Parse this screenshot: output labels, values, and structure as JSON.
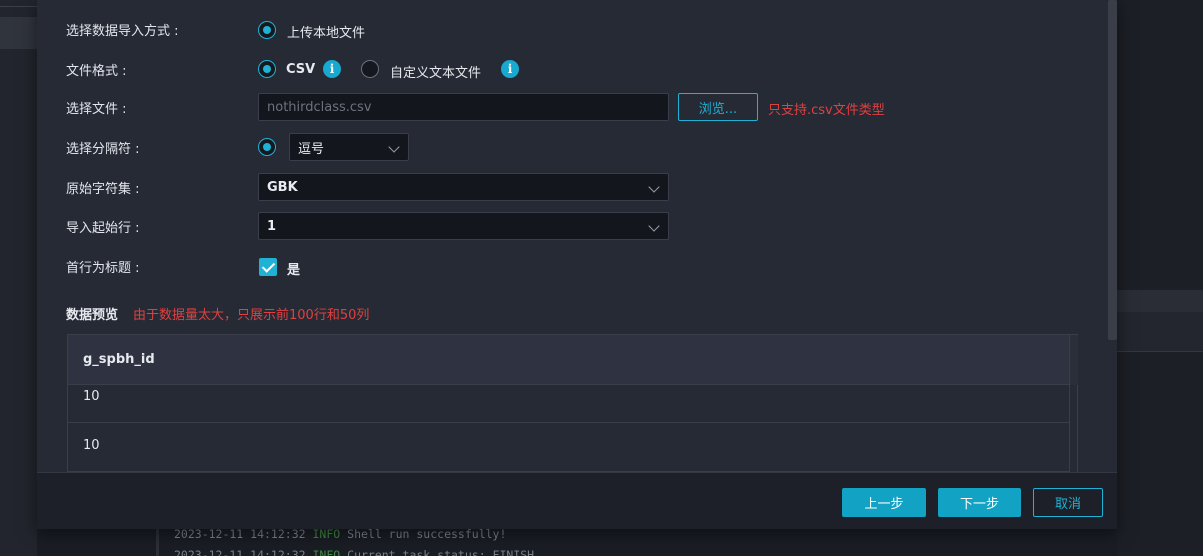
{
  "form": {
    "import_mode": {
      "label": "选择数据导入方式 :",
      "option": "上传本地文件"
    },
    "file_format": {
      "label": "文件格式 :",
      "option_csv": "CSV",
      "option_custom": "自定义文本文件",
      "info_glyph": "i"
    },
    "file_select": {
      "label": "选择文件 :",
      "value": "nothirdclass.csv",
      "browse_label": "浏览...",
      "hint": "只支持.csv文件类型"
    },
    "delimiter": {
      "label": "选择分隔符 :",
      "value": "逗号"
    },
    "charset": {
      "label": "原始字符集 :",
      "value": "GBK"
    },
    "start_row": {
      "label": "导入起始行 :",
      "value": "1"
    },
    "header_row": {
      "label": "首行为标题 :",
      "checkbox_label": "是",
      "checked": true
    }
  },
  "preview": {
    "title": "数据预览",
    "note": "由于数据量太大，只展示前100行和50列",
    "columns": [
      "g_spbh_id"
    ],
    "rows": [
      [
        "10"
      ],
      [
        "10"
      ]
    ]
  },
  "footer": {
    "prev_label": "上一步",
    "next_label": "下一步",
    "cancel_label": "取消"
  },
  "background_log": {
    "line1": {
      "time": "2023-12-11 14:12:32",
      "level": "INFO",
      "msg": "Shell run successfully!"
    },
    "line2": {
      "time": "2023-12-11 14:12:32",
      "level": "INFO",
      "msg": "Current task status: FINISH"
    }
  },
  "colors": {
    "accent": "#1fb2d4",
    "error": "#e0403f",
    "modal_bg": "#262a35"
  }
}
